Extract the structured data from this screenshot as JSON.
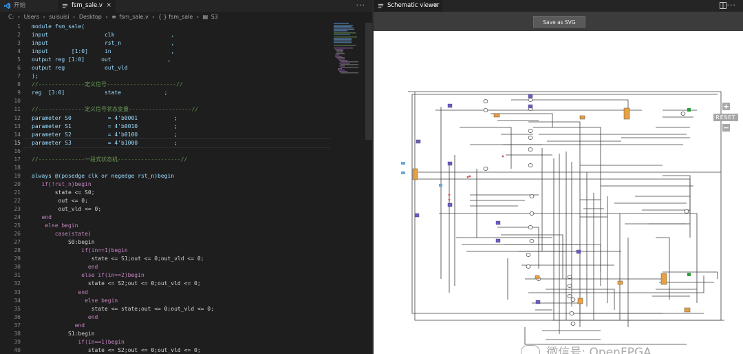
{
  "editor": {
    "tabs": [
      {
        "label": "开始",
        "active": false
      },
      {
        "label": "fsm_sale.v",
        "active": true,
        "close": "×"
      }
    ],
    "more_actions": "···",
    "breadcrumb": [
      "C:",
      "Users",
      "suisuisi",
      "Desktop",
      "fsm_sale.v",
      "{ } fsm_sale",
      "S3"
    ],
    "lines": [
      {
        "n": "1",
        "t": "module fsm_sale("
      },
      {
        "n": "2",
        "t": "input                 clk                 ,"
      },
      {
        "n": "3",
        "t": "input                 rst_n               ,"
      },
      {
        "n": "4",
        "t": "input       [1:0]     in                  ,"
      },
      {
        "n": "5",
        "t": "output reg [1:0]     out                 ,"
      },
      {
        "n": "6",
        "t": "output reg            out_vld"
      },
      {
        "n": "7",
        "t": ");"
      },
      {
        "n": "8",
        "t": "//--------------定义信号---------------------//"
      },
      {
        "n": "9",
        "t": "reg  [3:0]            state             ;"
      },
      {
        "n": "10",
        "t": ""
      },
      {
        "n": "11",
        "t": "//--------------定义信号状态变量-------------------//"
      },
      {
        "n": "12",
        "t": "parameter S0           = 4'b0001           ;"
      },
      {
        "n": "13",
        "t": "parameter S1           = 4'b0010           ;"
      },
      {
        "n": "14",
        "t": "parameter S2           = 4'b0100           ;"
      },
      {
        "n": "15",
        "t": "parameter S3           = 4'b1000           ;"
      },
      {
        "n": "16",
        "t": ""
      },
      {
        "n": "17",
        "t": "//--------------一段式状态机-------------------//"
      },
      {
        "n": "18",
        "t": ""
      },
      {
        "n": "19",
        "t": "always @(posedge clk or negedge rst_n)begin"
      },
      {
        "n": "20",
        "t": "   if(!rst_n)begin"
      },
      {
        "n": "21",
        "t": "       state <= S0;"
      },
      {
        "n": "22",
        "t": "        out <= 0;"
      },
      {
        "n": "23",
        "t": "        out_vld <= 0;"
      },
      {
        "n": "24",
        "t": "   end"
      },
      {
        "n": "25",
        "t": "    else begin"
      },
      {
        "n": "26",
        "t": "       case(state)"
      },
      {
        "n": "27",
        "t": "           S0:begin"
      },
      {
        "n": "28",
        "t": "               if(in==1)begin"
      },
      {
        "n": "29",
        "t": "                  state <= S1;out <= 0;out_vld <= 0;"
      },
      {
        "n": "30",
        "t": "                 end"
      },
      {
        "n": "31",
        "t": "               else if(in==2)begin"
      },
      {
        "n": "32",
        "t": "                 state <= S2;out <= 0;out_vld <= 0;"
      },
      {
        "n": "33",
        "t": "              end"
      },
      {
        "n": "34",
        "t": "                else begin"
      },
      {
        "n": "35",
        "t": "                  state <= state;out <= 0;out_vld <= 0;"
      },
      {
        "n": "36",
        "t": "                 end"
      },
      {
        "n": "37",
        "t": "             end"
      },
      {
        "n": "38",
        "t": "           S1:begin"
      },
      {
        "n": "39",
        "t": "              if(in==1)begin"
      },
      {
        "n": "40",
        "t": "                 state <= S2;out <= 0;out_vld <= 0;"
      }
    ]
  },
  "viewer": {
    "tab_label": "Schematic viewer",
    "tab_close": "×",
    "save_button": "Save as SVG",
    "zoom_in": "+",
    "reset": "RESET",
    "zoom_out": "−"
  },
  "watermark": "微信号: OpenFPGA",
  "colors": {
    "keyword": "#569cd6",
    "identifier": "#9cdcfe",
    "comment": "#6a9955",
    "number": "#b5cea8",
    "control": "#c586c0"
  }
}
